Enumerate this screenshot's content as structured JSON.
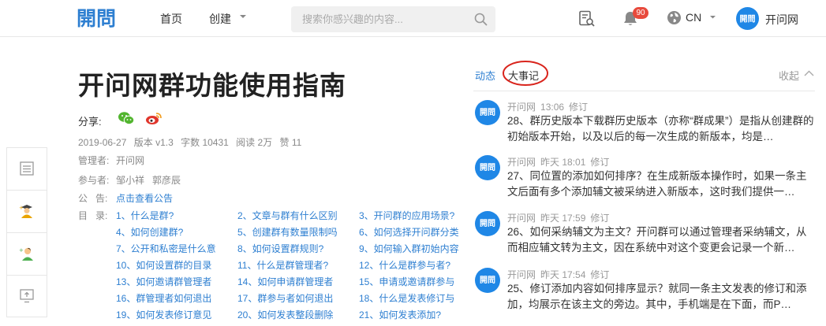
{
  "header": {
    "logo_text": "開問",
    "nav": {
      "home": "首页",
      "create": "创建"
    },
    "search": {
      "placeholder": "搜索你感兴趣的内容..."
    },
    "notification_count": "90",
    "language": "CN",
    "user_name": "开问网"
  },
  "article": {
    "title": "开问网群功能使用指南",
    "share_label": "分享:",
    "meta": {
      "date": "2019-06-27",
      "version": "版本 v1.3",
      "word_count": "字数 10431",
      "reads": "阅读 2万",
      "likes": "赞 11"
    },
    "manager_label": "管理者:",
    "manager": "开问网",
    "participants_label": "参与者:",
    "participants": "邹小祥   郭彦辰",
    "notice_label": "公   告:",
    "notice_link": "点击查看公告",
    "toc_label": "目   录:",
    "toc": [
      [
        "1、什么是群?",
        "2、文章与群有什么区别",
        "3、开问群的应用场景?"
      ],
      [
        "4、如何创建群?",
        "5、创建群有数量限制吗",
        "6、如何选择开问群分类"
      ],
      [
        "7、公开和私密是什么意",
        "8、如何设置群规则?",
        "9、如何输入群初始内容"
      ],
      [
        "10、如何设置群的目录",
        "11、什么是群管理者?",
        "12、什么是群参与者?"
      ],
      [
        "13、如何邀请群管理者",
        "14、如何申请群管理者",
        "15、申请或邀请群参与"
      ],
      [
        "16、群管理者如何退出",
        "17、群参与者如何退出",
        "18、什么是发表修订与"
      ],
      [
        "19、如何发表修订意见",
        "20、如何发表整段删除",
        "21、如何发表添加?"
      ]
    ]
  },
  "sidetool": {
    "icons": [
      "list-icon",
      "teacher-icon",
      "user-add-icon",
      "export-icon"
    ]
  },
  "panel": {
    "tab_dynamic": "动态",
    "tab_events": "大事记",
    "collapse": "收起",
    "feed": [
      {
        "author": "开问网",
        "time": "13:06",
        "action": "修订",
        "text": "28、群历史版本下载群历史版本（亦称“群成果”）是指从创建群的初始版本开始，以及以后的每一次生成的新版本，均是…"
      },
      {
        "author": "开问网",
        "time": "昨天 18:01",
        "action": "修订",
        "text": "27、同位置的添加如何排序？在生成新版本操作时，如果一条主文后面有多个添加辅文被采纳进入新版本，这时我们提供一…"
      },
      {
        "author": "开问网",
        "time": "昨天 17:59",
        "action": "修订",
        "text": "26、如何采纳辅文为主文？开问群可以通过管理者采纳辅文，从而相应辅文转为主文，因在系统中对这个变更会记录一个新…"
      },
      {
        "author": "开问网",
        "time": "昨天 17:54",
        "action": "修订",
        "text": "25、修订添加内容如何排序显示？就同一条主文发表的修订和添加，均展示在该主文的旁边。其中，手机端是在下面，而P…"
      }
    ]
  },
  "colors": {
    "brand_blue": "#2e7fd1",
    "badge_red": "#e84a3c",
    "annotation_red": "#d9241c"
  }
}
